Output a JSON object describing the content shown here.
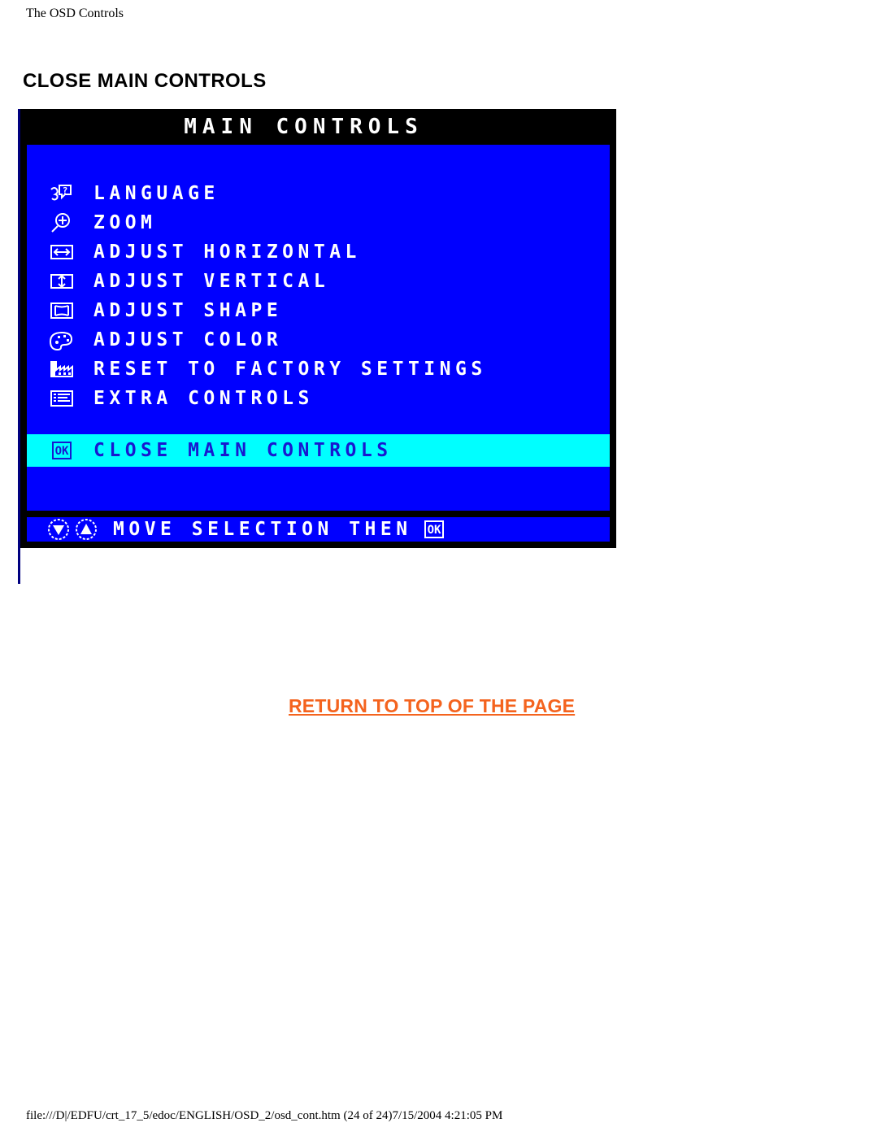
{
  "document": {
    "running_head": "The OSD Controls",
    "heading": "CLOSE MAIN CONTROLS",
    "return_link": "RETURN TO TOP OF THE PAGE",
    "footer_path": "file:///D|/EDFU/crt_17_5/edoc/ENGLISH/OSD_2/osd_cont.htm (24 of 24)7/15/2004 4:21:05 PM"
  },
  "colors": {
    "osd_background": "#0000FF",
    "osd_frame": "#000000",
    "osd_highlight": "#00FFFF",
    "osd_highlight_text": "#1818D0",
    "osd_text": "#FFFFFF",
    "link_orange": "#F4631E",
    "left_rule_navy": "#000080"
  },
  "osd": {
    "title": "MAIN CONTROLS",
    "menu_items": [
      {
        "icon": "language-icon",
        "label": "LANGUAGE",
        "selected": false
      },
      {
        "icon": "zoom-icon",
        "label": "ZOOM",
        "selected": false
      },
      {
        "icon": "adjust-horizontal-icon",
        "label": "ADJUST HORIZONTAL",
        "selected": false
      },
      {
        "icon": "adjust-vertical-icon",
        "label": "ADJUST VERTICAL",
        "selected": false
      },
      {
        "icon": "adjust-shape-icon",
        "label": "ADJUST SHAPE",
        "selected": false
      },
      {
        "icon": "adjust-color-icon",
        "label": "ADJUST COLOR",
        "selected": false
      },
      {
        "icon": "reset-factory-icon",
        "label": "RESET TO FACTORY SETTINGS",
        "selected": false
      },
      {
        "icon": "extra-controls-icon",
        "label": "EXTRA CONTROLS",
        "selected": false
      }
    ],
    "selected_item": {
      "icon": "ok-button-icon",
      "label": "CLOSE MAIN CONTROLS",
      "selected": true
    },
    "hint": {
      "icons": [
        "arrow-down-icon",
        "arrow-up-icon"
      ],
      "label": "MOVE SELECTION THEN",
      "trailing_icon": "ok-button-icon"
    }
  }
}
